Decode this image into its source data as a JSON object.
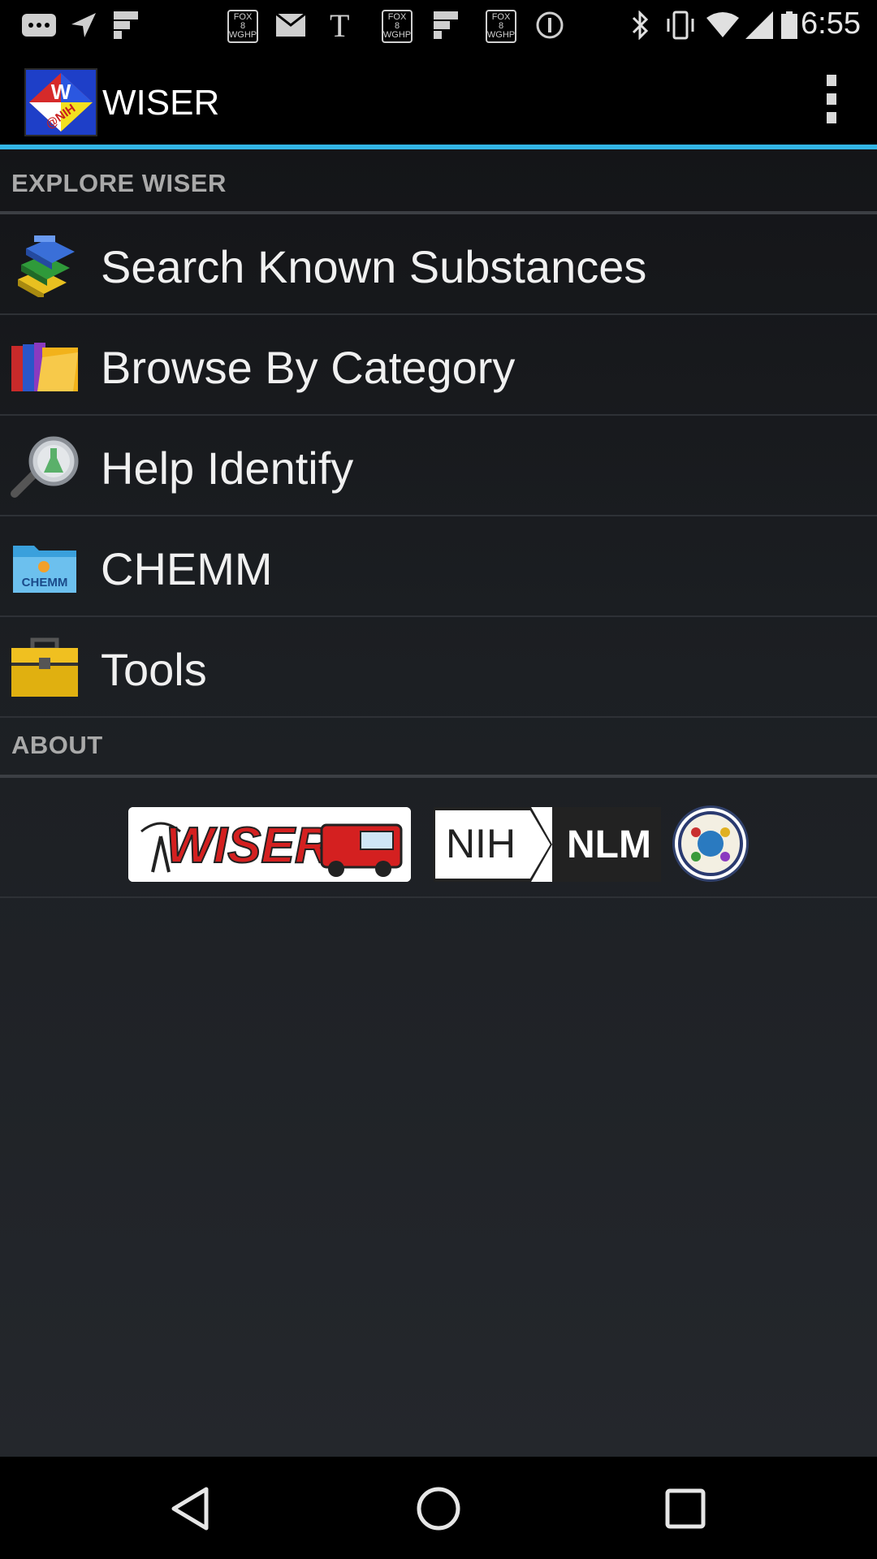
{
  "status_bar": {
    "time": "6:55",
    "fox_badge_1": "FOX\n8\nWGHP",
    "fox_badge_2": "FOX\n8\nWGHP",
    "fox_badge_3": "FOX\n8\nWGHP",
    "icons": [
      "messages-icon",
      "navigation-icon",
      "flipboard-icon",
      "fox8-icon",
      "email-icon",
      "nyt-icon",
      "fox8-icon",
      "flipboard-icon",
      "fox8-icon",
      "alert-icon",
      "bluetooth-icon",
      "vibrate-icon",
      "wifi-icon",
      "signal-icon",
      "battery-icon"
    ]
  },
  "action_bar": {
    "title": "WISER",
    "logo_text": "W",
    "logo_sub": "@NIH"
  },
  "sections": {
    "explore": "EXPLORE WISER",
    "about": "ABOUT"
  },
  "menu": [
    {
      "label": "Search Known Substances",
      "icon": "books-icon"
    },
    {
      "label": "Browse By Category",
      "icon": "folders-icon"
    },
    {
      "label": "Help Identify",
      "icon": "magnifier-icon"
    },
    {
      "label": "CHEMM",
      "icon": "chemm-folder-icon",
      "icon_text": "CHEMM"
    },
    {
      "label": "Tools",
      "icon": "toolbox-icon"
    }
  ],
  "banner": {
    "wiser_logo_text": "WISER",
    "nih_text": "NIH",
    "nlm_text": "NLM"
  },
  "colors": {
    "accent": "#33b5e5",
    "background": "#1c1f23",
    "wiser_red": "#d42020"
  }
}
